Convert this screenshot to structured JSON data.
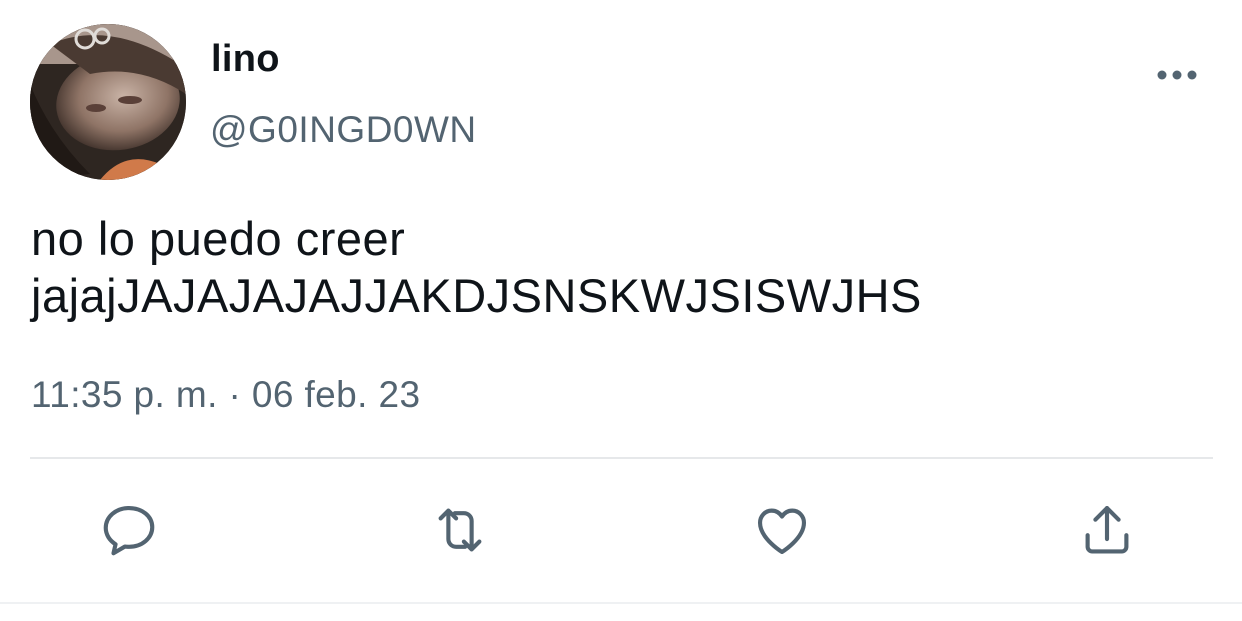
{
  "tweet": {
    "display_name": "lino",
    "handle": "@G0INGD0WN",
    "text_lines": [
      "no lo puedo creer",
      "jajajJAJAJAJAJJAKDJSNSKWJSISWJHS"
    ],
    "timestamp": "11:35 p. m. · 06 feb. 23"
  },
  "actions": [
    {
      "name": "reply",
      "icon": "reply-icon"
    },
    {
      "name": "retweet",
      "icon": "retweet-icon"
    },
    {
      "name": "like",
      "icon": "heart-icon"
    },
    {
      "name": "share",
      "icon": "share-icon"
    }
  ],
  "menu": {
    "icon": "more-options-icon"
  },
  "colors": {
    "text_primary": "#0f1419",
    "text_secondary": "#536471",
    "icon": "#536471",
    "divider": "#e6e8ea"
  }
}
